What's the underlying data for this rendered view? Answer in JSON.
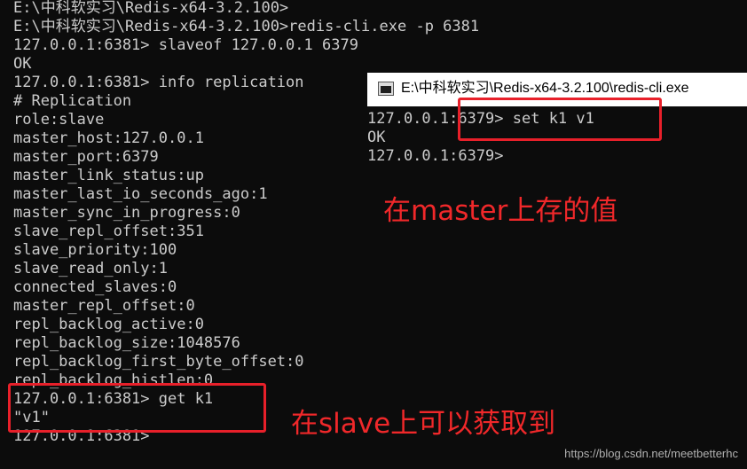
{
  "left_terminal": {
    "lines": [
      "E:\\中科软实习\\Redis-x64-3.2.100>",
      "E:\\中科软实习\\Redis-x64-3.2.100>redis-cli.exe -p 6381",
      "127.0.0.1:6381> slaveof 127.0.0.1 6379",
      "OK",
      "127.0.0.1:6381> info replication",
      "# Replication",
      "role:slave",
      "master_host:127.0.0.1",
      "master_port:6379",
      "master_link_status:up",
      "master_last_io_seconds_ago:1",
      "master_sync_in_progress:0",
      "slave_repl_offset:351",
      "slave_priority:100",
      "slave_read_only:1",
      "connected_slaves:0",
      "master_repl_offset:0",
      "repl_backlog_active:0",
      "repl_backlog_size:1048576",
      "repl_backlog_first_byte_offset:0",
      "repl_backlog_histlen:0",
      "127.0.0.1:6381> get k1",
      "\"v1\"",
      "127.0.0.1:6381>"
    ]
  },
  "right_window": {
    "title": "E:\\中科软实习\\Redis-x64-3.2.100\\redis-cli.exe",
    "lines": [
      "127.0.0.1:6379> set k1 v1",
      "OK",
      "127.0.0.1:6379>"
    ]
  },
  "annotations": {
    "master_note": "在master上存的值",
    "slave_note": "在slave上可以获取到"
  },
  "watermark": "https://blog.csdn.net/meetbetterhc",
  "colors": {
    "background": "#0c0c0c",
    "text": "#cccccc",
    "annotation": "#f0282a"
  }
}
